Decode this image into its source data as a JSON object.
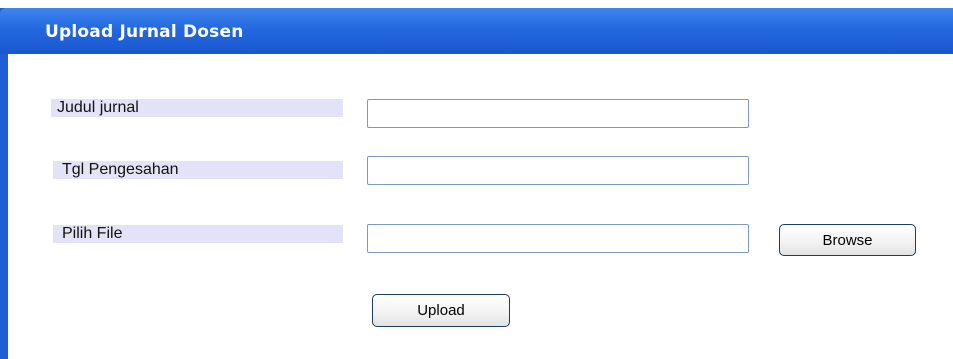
{
  "window": {
    "title": "Upload Jurnal Dosen"
  },
  "form": {
    "judul_label": "Judul jurnal",
    "judul_value": "",
    "tgl_label": "Tgl Pengesahan",
    "tgl_value": "",
    "file_label": "Pilih File",
    "file_value": "",
    "browse_label": "Browse",
    "upload_label": "Upload"
  },
  "colors": {
    "titlebar": "#2368df",
    "label_bg": "#e3e3f8",
    "button_border": "#1d3d63"
  }
}
